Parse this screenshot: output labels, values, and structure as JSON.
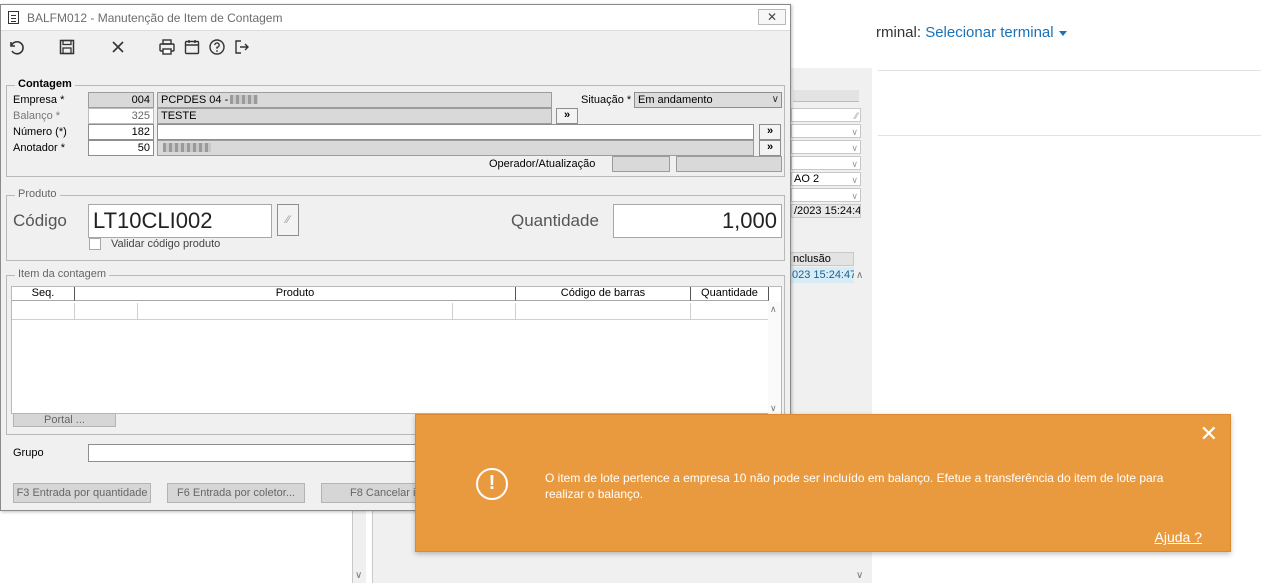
{
  "background": {
    "terminal_label": "rminal:",
    "terminal_link": "Selecionar terminal",
    "field_values": [
      "",
      "",
      "",
      "",
      "AO 2",
      ""
    ],
    "timestamp_field": "/2023 15:24:40",
    "grid_header": "nclusão",
    "grid_value": "023 15:24:47"
  },
  "window": {
    "title": "BALFM012 - Manutenção de Item de Contagem",
    "close_symbol": "✕"
  },
  "toolbar": {
    "icons": [
      "undo-icon",
      "save-icon",
      "cancel-icon",
      "print-icon",
      "calendar-icon",
      "help-icon",
      "exit-icon"
    ]
  },
  "contagem": {
    "title": "Contagem",
    "empresa_label": "Empresa *",
    "empresa_code": "004",
    "empresa_name": "PCPDES 04 -",
    "balanco_label": "Balanço *",
    "balanco_code": "325",
    "balanco_name": "TESTE",
    "numero_label": "Número (*)",
    "numero_value": "182",
    "anotador_label": "Anotador *",
    "anotador_code": "50",
    "situacao_label": "Situação *",
    "situacao_value": "Em andamento",
    "operador_label": "Operador/Atualização",
    "lookup_symbol": "»"
  },
  "produto": {
    "title": "Produto",
    "codigo_label": "Código",
    "codigo_value": "LT10CLI002",
    "quantidade_label": "Quantidade",
    "quantidade_value": "1,000",
    "validar_label": "Validar código produto"
  },
  "itens": {
    "title": "Item da contagem",
    "columns": [
      "Seq.",
      "Produto",
      "Código de barras",
      "Quantidade"
    ]
  },
  "portal_button": "Portal ...",
  "grupo_label": "Grupo",
  "buttons": {
    "f3": "F3 Entrada por quantidade",
    "f6": "F6 Entrada por coletor...",
    "f8": "F8 Cancelar it"
  },
  "toast": {
    "message": "O item de lote pertence a empresa 10 não pode ser incluído em balanço. Efetue a transferência do item de lote para realizar o balanço.",
    "help_link": "Ajuda ?",
    "close_symbol": "✕",
    "alert_symbol": "!",
    "color": "#ea9a3e"
  }
}
